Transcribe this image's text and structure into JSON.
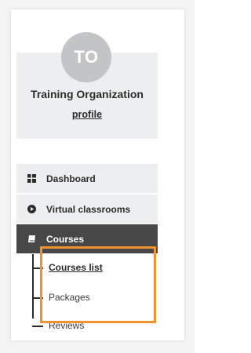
{
  "organization": {
    "initials": "TO",
    "name": "Training Organization",
    "profile_link": "profile"
  },
  "nav": {
    "items": [
      {
        "label": "Dashboard",
        "icon": "grid-icon"
      },
      {
        "label": "Virtual classrooms",
        "icon": "play-circle-icon"
      },
      {
        "label": "Courses",
        "icon": "book-icon",
        "active": true
      }
    ],
    "subitems": [
      {
        "label": "Courses list",
        "current": true
      },
      {
        "label": "Packages"
      },
      {
        "label": "Reviews"
      }
    ]
  },
  "colors": {
    "accent_highlight": "#f0922e",
    "active_nav_bg": "#474747",
    "nav_bg": "#eceeef",
    "avatar_bg": "#c2c4c6"
  }
}
